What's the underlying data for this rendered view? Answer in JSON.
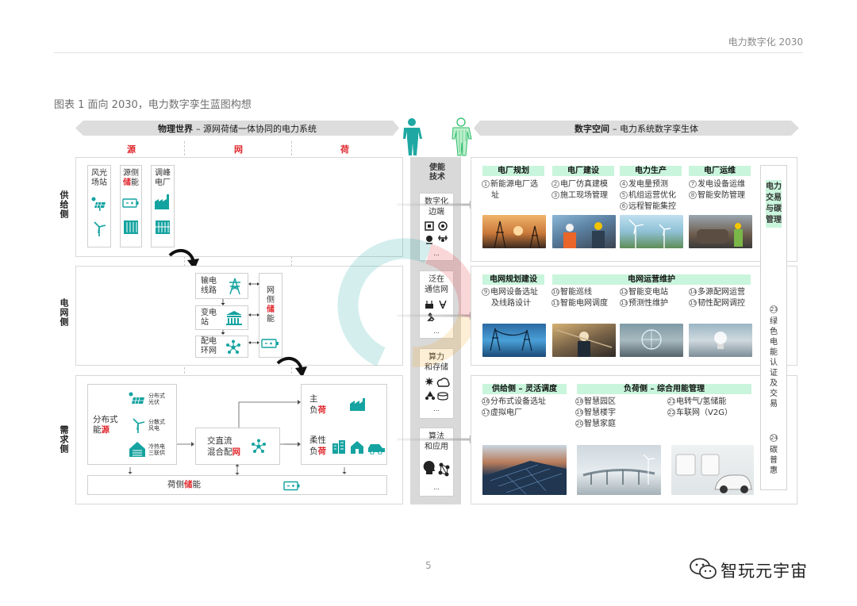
{
  "header": {
    "title": "电力数字化 2030"
  },
  "caption": "图表 1 面向 2030，电力数字孪生蓝图构想",
  "banner_left": {
    "bold": "物理世界",
    "rest": " – 源网荷储一体协同的电力系统"
  },
  "banner_right": {
    "bold": "数字空间",
    "rest": " – 电力系统数字孪生体"
  },
  "columns": [
    "源",
    "网",
    "荷"
  ],
  "rows": {
    "supply": "供给侧",
    "grid": "电网侧",
    "demand": "需求侧"
  },
  "supply": {
    "box1": {
      "line1": "风光",
      "line2": "场站"
    },
    "box2": {
      "line1": "源侧",
      "line2_red": "储",
      "line2_rest": "能"
    },
    "box3": {
      "line1": "调峰",
      "line2": "电厂"
    }
  },
  "grid": {
    "transmission": {
      "line1": "输电",
      "line2": "线路"
    },
    "substation": {
      "line1": "变电",
      "line2": "站"
    },
    "distribution": {
      "line1": "配电",
      "line2": "环网"
    },
    "storage": {
      "line1": "网",
      "line2": "侧",
      "line3_red": "储",
      "line4": "能"
    }
  },
  "demand": {
    "distributed": {
      "line1": "分布式",
      "line2_a": "能",
      "line2_red": "源"
    },
    "items": [
      {
        "line1": "分布式",
        "line2": "光伏"
      },
      {
        "line1": "分散式",
        "line2": "风电"
      },
      {
        "line1": "冷热电",
        "line2": "三联供"
      }
    ],
    "acdc": {
      "line1": "交直流",
      "line2_a": "混合配",
      "line2_red": "网"
    },
    "main_load": {
      "line1": "主",
      "line2_a": "负",
      "line2_red": "荷"
    },
    "flex_load": {
      "line1": "柔性",
      "line2_a": "负",
      "line2_red": "荷"
    },
    "load_storage": {
      "a": "荷侧",
      "red": "储",
      "b": "能"
    }
  },
  "enablers": {
    "title": "使能技术",
    "items": [
      {
        "line1": "数字化",
        "line2": "边端"
      },
      {
        "line1": "泛在",
        "line2": "通信网"
      },
      {
        "line1": "算力",
        "line2": "和存储"
      },
      {
        "line1": "算法",
        "line2": "和应用"
      }
    ],
    "ellipsis": "..."
  },
  "digital": {
    "supply_heads": [
      "电厂规划",
      "电厂建设",
      "电力生产",
      "电厂运维"
    ],
    "supply_items": [
      [
        {
          "n": "1",
          "t": "新能源电厂选",
          "t2": "址"
        }
      ],
      [
        {
          "n": "2",
          "t": "电厂仿真建模"
        },
        {
          "n": "3",
          "t": "施工现场管理"
        }
      ],
      [
        {
          "n": "4",
          "t": "发电量预测"
        },
        {
          "n": "5",
          "t": "机组运营优化"
        },
        {
          "n": "6",
          "t": "远程智能集控"
        }
      ],
      [
        {
          "n": "7",
          "t": "发电设备运维"
        },
        {
          "n": "8",
          "t": "智能安防管理"
        }
      ]
    ],
    "grid_heads": [
      "电网规划建设",
      "电网运营维护"
    ],
    "grid_items": [
      [
        {
          "n": "9",
          "t": "电网设备选址",
          "t2": "及线路设计"
        }
      ],
      [
        {
          "n": "10",
          "t": "智能巡线"
        },
        {
          "n": "11",
          "t": "智能电网调度"
        }
      ],
      [
        {
          "n": "12",
          "t": "智能变电站"
        },
        {
          "n": "13",
          "t": "预测性维护"
        }
      ],
      [
        {
          "n": "14",
          "t": "多源配网运营"
        },
        {
          "n": "15",
          "t": "韧性配网调控"
        }
      ]
    ],
    "demand_heads": [
      "供给侧 – 灵活调度",
      "负荷侧 – 综合用能管理"
    ],
    "demand_items": [
      [
        {
          "n": "16",
          "t": "分布式设备选址"
        },
        {
          "n": "17",
          "t": "虚拟电厂"
        }
      ],
      [
        {
          "n": "18",
          "t": "智慧园区"
        },
        {
          "n": "19",
          "t": "智慧楼宇"
        },
        {
          "n": "20",
          "t": "智慧家庭"
        }
      ],
      [
        {
          "n": "21",
          "t": "电转气/氢储能"
        },
        {
          "n": "22",
          "t": "车联网（V2G）"
        }
      ]
    ]
  },
  "side": {
    "title": "电力交易与碳管理",
    "item23": {
      "n": "23",
      "t": "绿色电能认证及交易"
    },
    "item24": {
      "n": "24",
      "t": "碳普惠"
    }
  },
  "page_number": "5",
  "watermark": "智玩元宇宙",
  "colors": {
    "accent_red": "#e0282e",
    "teal": "#14a3a0",
    "mint": "#c9f5dc"
  }
}
